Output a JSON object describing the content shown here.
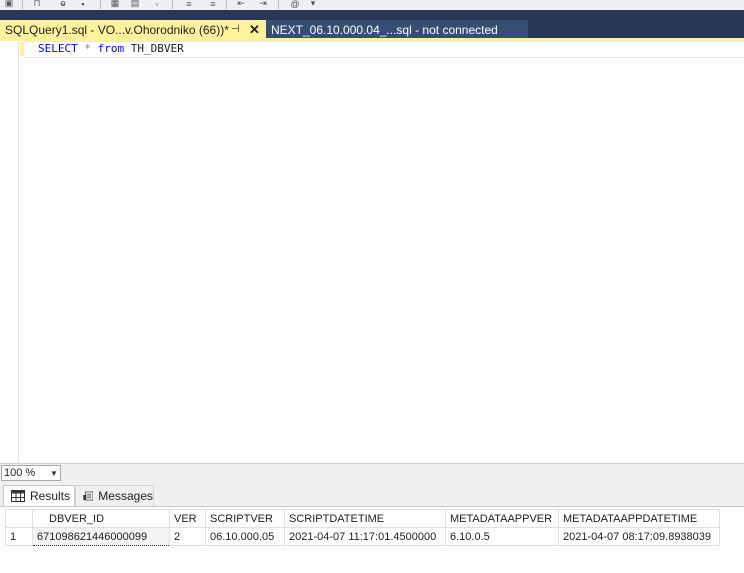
{
  "tabs": {
    "active_label": "SQLQuery1.sql - VO...v.Ohorodniko (66))*",
    "pin_glyph": "⊣",
    "close_glyph": "✕",
    "inactive_label": "NEXT_06.10.000.04_...sql - not connected"
  },
  "editor": {
    "kw_select": "SELECT",
    "star": "*",
    "kw_from": "from",
    "table_name": "TH_DBVER"
  },
  "zoom": {
    "value": "100 %"
  },
  "result_tabs": {
    "results": "Results",
    "messages": "Messages"
  },
  "grid": {
    "columns": [
      "DBVER_ID",
      "VER",
      "SCRIPTVER",
      "SCRIPTDATETIME",
      "METADATAAPPVER",
      "METADATAAPPDATETIME"
    ],
    "rows": [
      {
        "num": "1",
        "cells": [
          "671098621446000099",
          "2",
          "06.10.000.05",
          "2021-04-07 11:17:01.4500000",
          "6.10.0.5",
          "2021-04-07 08:17:09.8938039"
        ]
      }
    ]
  },
  "colors": {
    "tab_strip": "#293955",
    "active_tab": "#fff29d",
    "inactive_tab": "#364e6f",
    "keyword": "#0000ff"
  }
}
